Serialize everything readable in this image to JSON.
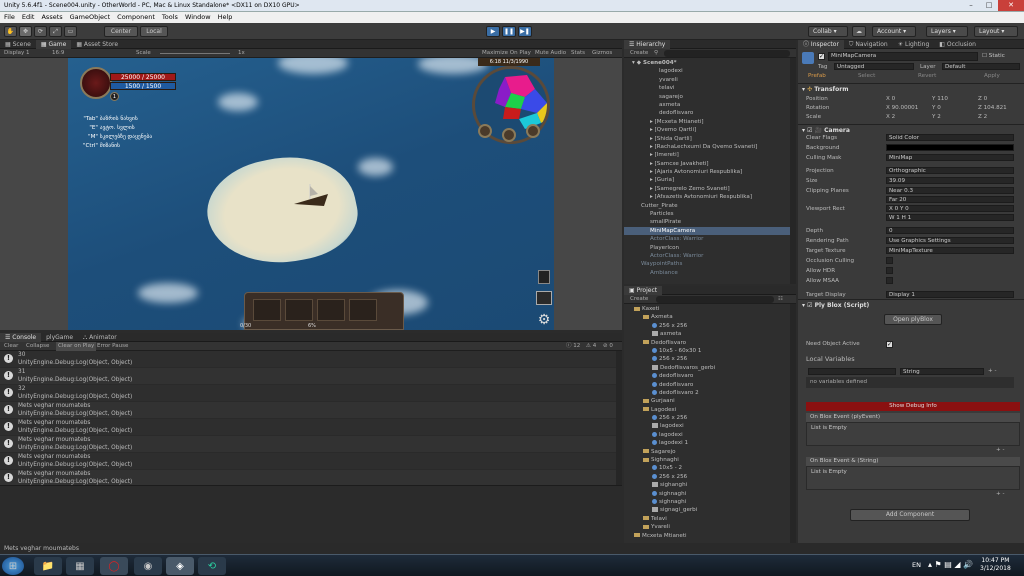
{
  "window": {
    "title": "Unity 5.6.4f1 - Scene004.unity - OtherWorld - PC, Mac & Linux Standalone* <DX11 on DX10 GPU>",
    "menu": [
      "File",
      "Edit",
      "Assets",
      "GameObject",
      "Component",
      "Tools",
      "Window",
      "Help"
    ]
  },
  "toolbar": {
    "center_label": "Center",
    "local_label": "Local",
    "collab_label": "Collab",
    "account_label": "Account",
    "layers_label": "Layers",
    "layout_label": "Layout"
  },
  "scene_tabs": [
    "Scene",
    "Game",
    "Asset Store"
  ],
  "game_bar": {
    "display": "Display 1",
    "aspect": "16:9",
    "scale_label": "Scale",
    "scale_value": "1x",
    "maximize": "Maximize On Play",
    "mute": "Mute Audio",
    "stats": "Stats",
    "gizmos": "Gizmos"
  },
  "hud": {
    "hp": "25000 / 25000",
    "mp": "1500 / 1500",
    "level": "1",
    "keys": [
      {
        "key": "\"Tab\"",
        "text": "ბაზრის ნახვის"
      },
      {
        "key": "\"E\"",
        "text": "ავტო. სვლის"
      },
      {
        "key": "\"M\"",
        "text": "სკილებზე დაყენება"
      },
      {
        "key": "\"Ctrl\"",
        "text": "მიზანის"
      }
    ],
    "time": "6:18",
    "date": "11/3/1990",
    "bottom_left": "0/30",
    "bottom_mid": "6%"
  },
  "hierarchy": {
    "title": "Hierarchy",
    "create": "Create",
    "scene": "Scene004*",
    "items": [
      {
        "label": "lagodexi",
        "indent": 3
      },
      {
        "label": "yvareli",
        "indent": 3
      },
      {
        "label": "telavi",
        "indent": 3
      },
      {
        "label": "sagarejo",
        "indent": 3
      },
      {
        "label": "axmeta",
        "indent": 3
      },
      {
        "label": "dedoflisvaro",
        "indent": 3
      },
      {
        "label": "[Mcxeta Mtianeti]",
        "indent": 2
      },
      {
        "label": "[Qvemo Qartli]",
        "indent": 2
      },
      {
        "label": "[Shida Qartli]",
        "indent": 2
      },
      {
        "label": "[RachaLechxumi Da Qvemo Svaneti]",
        "indent": 2
      },
      {
        "label": "[Imereti]",
        "indent": 2
      },
      {
        "label": "[Samcxe Javakheti]",
        "indent": 2
      },
      {
        "label": "[Ajaris Avtonomiuri Respublika]",
        "indent": 2
      },
      {
        "label": "[Guria]",
        "indent": 2
      },
      {
        "label": "[Samegrelo Zemo Svaneti]",
        "indent": 2
      },
      {
        "label": "[Afxazetis Avtonomiuri Respublika]",
        "indent": 2
      },
      {
        "label": "Cutter_Pirate",
        "indent": 1
      },
      {
        "label": "Particles",
        "indent": 2
      },
      {
        "label": "smallPirate",
        "indent": 2
      },
      {
        "label": "MiniMapCamera",
        "indent": 2,
        "sel": true
      },
      {
        "label": "ActorClass: Warrior",
        "indent": 2,
        "dim": true
      },
      {
        "label": "PlayerIcon",
        "indent": 2
      },
      {
        "label": "ActorClass: Warrior",
        "indent": 2,
        "dim": true
      },
      {
        "label": "WaypointPaths",
        "indent": 1,
        "dim": true
      },
      {
        "label": "Ambiance",
        "indent": 2,
        "dim": true
      }
    ]
  },
  "project": {
    "title": "Project",
    "create": "Create",
    "items": [
      {
        "label": "Kaxeti",
        "indent": 0,
        "icon": "folder"
      },
      {
        "label": "Axmeta",
        "indent": 1,
        "icon": "folder"
      },
      {
        "label": "256 x 256",
        "indent": 2,
        "icon": "sphere"
      },
      {
        "label": "axmeta",
        "indent": 2,
        "icon": "img"
      },
      {
        "label": "Dedoflisvaro",
        "indent": 1,
        "icon": "folder"
      },
      {
        "label": "10x5 - 60x30 1",
        "indent": 2,
        "icon": "sphere"
      },
      {
        "label": "256 x 256",
        "indent": 2,
        "icon": "sphere"
      },
      {
        "label": "Dedoflisvaros_gerbi",
        "indent": 2,
        "icon": "img"
      },
      {
        "label": "dedoflisvaro",
        "indent": 2,
        "icon": "sphere"
      },
      {
        "label": "dedoflisvaro",
        "indent": 2,
        "icon": "sphere"
      },
      {
        "label": "dedoflisvaro 2",
        "indent": 2,
        "icon": "sphere"
      },
      {
        "label": "Gurjaani",
        "indent": 1,
        "icon": "folder"
      },
      {
        "label": "Lagodexi",
        "indent": 1,
        "icon": "folder"
      },
      {
        "label": "256 x 256",
        "indent": 2,
        "icon": "sphere"
      },
      {
        "label": "lagodexi",
        "indent": 2,
        "icon": "img"
      },
      {
        "label": "lagodexi",
        "indent": 2,
        "icon": "sphere"
      },
      {
        "label": "lagodexi 1",
        "indent": 2,
        "icon": "sphere"
      },
      {
        "label": "Sagarejo",
        "indent": 1,
        "icon": "folder"
      },
      {
        "label": "Sighnaghi",
        "indent": 1,
        "icon": "folder"
      },
      {
        "label": "10x5 - 2",
        "indent": 2,
        "icon": "sphere"
      },
      {
        "label": "256 x 256",
        "indent": 2,
        "icon": "sphere"
      },
      {
        "label": "sighanghi",
        "indent": 2,
        "icon": "img"
      },
      {
        "label": "sighnaghi",
        "indent": 2,
        "icon": "sphere"
      },
      {
        "label": "sighnaghi",
        "indent": 2,
        "icon": "sphere"
      },
      {
        "label": "signagi_gerbi",
        "indent": 2,
        "icon": "img"
      },
      {
        "label": "Telavi",
        "indent": 1,
        "icon": "folder"
      },
      {
        "label": "Yvareli",
        "indent": 1,
        "icon": "folder"
      },
      {
        "label": "Mcxeta Mtianeti",
        "indent": 0,
        "icon": "folder"
      }
    ]
  },
  "inspector": {
    "tabs": [
      "Inspector",
      "Navigation",
      "Lighting",
      "Occlusion"
    ],
    "object_name": "MiniMapCamera",
    "static": "Static",
    "tag_label": "Tag",
    "tag": "Untagged",
    "layer_label": "Layer",
    "layer": "Default",
    "prefab": "Prefab",
    "select": "Select",
    "revert": "Revert",
    "apply": "Apply",
    "transform": {
      "title": "Transform",
      "position_label": "Position",
      "rotation_label": "Rotation",
      "scale_label": "Scale",
      "pos": [
        "X 0",
        "Y 110",
        "Z 0"
      ],
      "rot": [
        "X 90.00001",
        "Y 0",
        "Z 104.821"
      ],
      "scl": [
        "X 2",
        "Y 2",
        "Z 2"
      ]
    },
    "camera": {
      "title": "Camera",
      "rows": [
        {
          "label": "Clear Flags",
          "value": "Solid Color"
        },
        {
          "label": "Background",
          "value": ""
        },
        {
          "label": "Culling Mask",
          "value": "MiniMap"
        },
        {
          "label": "Projection",
          "value": "Orthographic"
        },
        {
          "label": "Size",
          "value": "39.09"
        },
        {
          "label": "Clipping Planes",
          "value": "Near 0.3"
        },
        {
          "label": "",
          "value": "Far 20"
        },
        {
          "label": "Viewport Rect",
          "value": "X 0   Y 0"
        },
        {
          "label": "",
          "value": "W 1   H 1"
        },
        {
          "label": "Depth",
          "value": "0"
        },
        {
          "label": "Rendering Path",
          "value": "Use Graphics Settings"
        },
        {
          "label": "Target Texture",
          "value": "MiniMapTexture"
        },
        {
          "label": "Occlusion Culling",
          "value": ""
        },
        {
          "label": "Allow HDR",
          "value": ""
        },
        {
          "label": "Allow MSAA",
          "value": ""
        },
        {
          "label": "Target Display",
          "value": "Display 1"
        }
      ]
    },
    "plyblox": {
      "title": "Ply Blox (Script)",
      "open": "Open plyBlox",
      "need_active": "Need Object Active",
      "local_vars": "Local Variables",
      "var_type": "String",
      "no_vars": "no variables defined",
      "debug": "Show Debug Info",
      "event1": "On Blox Event (plyEvent)",
      "event2": "On Blox Event & (String)",
      "empty": "List is Empty"
    },
    "add_component": "Add Component"
  },
  "console": {
    "tabs": [
      "Console",
      "plyGame",
      "Animator"
    ],
    "buttons": [
      "Clear",
      "Collapse",
      "Clear on Play",
      "Error Pause"
    ],
    "counts": [
      "12",
      "4",
      "0"
    ],
    "rows": [
      {
        "msg": "30",
        "trace": "UnityEngine.Debug:Log(Object, Object)"
      },
      {
        "msg": "31",
        "trace": "UnityEngine.Debug:Log(Object, Object)"
      },
      {
        "msg": "32",
        "trace": "UnityEngine.Debug:Log(Object, Object)"
      },
      {
        "msg": "Mets veghar moumatebs",
        "trace": "UnityEngine.Debug:Log(Object, Object)"
      },
      {
        "msg": "Mets veghar moumatebs",
        "trace": "UnityEngine.Debug:Log(Object, Object)"
      },
      {
        "msg": "Mets veghar moumatebs",
        "trace": "UnityEngine.Debug:Log(Object, Object)"
      },
      {
        "msg": "Mets veghar moumatebs",
        "trace": "UnityEngine.Debug:Log(Object, Object)"
      },
      {
        "msg": "Mets veghar moumatebs",
        "trace": "UnityEngine.Debug:Log(Object, Object)"
      }
    ]
  },
  "status_bar": "Mets veghar moumatebs",
  "taskbar": {
    "lang": "EN",
    "time": "10:47 PM",
    "date": "3/12/2018"
  }
}
